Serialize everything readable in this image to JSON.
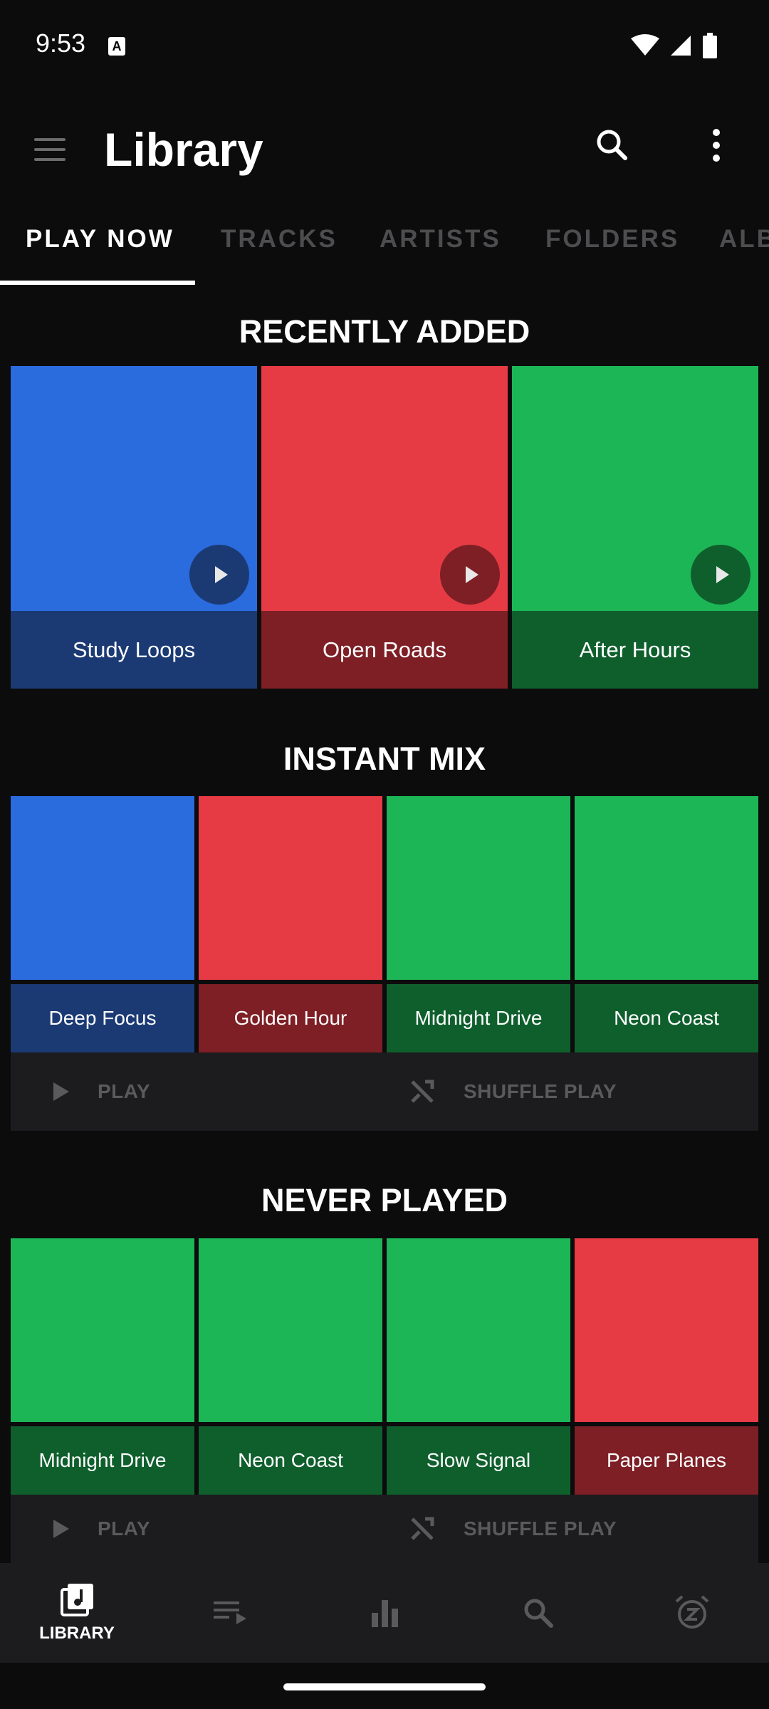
{
  "status_bar": {
    "time": "9:53",
    "badge": "A"
  },
  "app_bar": {
    "title": "Library"
  },
  "tabs": [
    {
      "label": "PLAY NOW",
      "active": true
    },
    {
      "label": "TRACKS",
      "active": false
    },
    {
      "label": "ARTISTS",
      "active": false
    },
    {
      "label": "FOLDERS",
      "active": false
    },
    {
      "label": "ALBUMS",
      "active": false
    }
  ],
  "recently_added": {
    "title": "RECENTLY ADDED",
    "items": [
      {
        "label": "Study Loops",
        "color": "blue"
      },
      {
        "label": "Open Roads",
        "color": "red"
      },
      {
        "label": "After Hours",
        "color": "green"
      }
    ]
  },
  "instant_mix": {
    "title": "INSTANT MIX",
    "items": [
      {
        "label": "Deep Focus",
        "color": "blue"
      },
      {
        "label": "Golden Hour",
        "color": "red"
      },
      {
        "label": "Midnight Drive",
        "color": "green"
      },
      {
        "label": "Neon Coast",
        "color": "green"
      }
    ],
    "play_label": "PLAY",
    "shuffle_label": "SHUFFLE PLAY"
  },
  "never_played": {
    "title": "NEVER PLAYED",
    "items": [
      {
        "label": "Midnight Drive",
        "color": "green"
      },
      {
        "label": "Neon Coast",
        "color": "green"
      },
      {
        "label": "Slow Signal",
        "color": "green"
      },
      {
        "label": "Paper Planes",
        "color": "red"
      }
    ],
    "play_label": "PLAY",
    "shuffle_label": "SHUFFLE PLAY"
  },
  "bottom_nav": [
    {
      "label": "LIBRARY",
      "icon": "library-icon",
      "active": true
    },
    {
      "label": "",
      "icon": "queue-icon",
      "active": false
    },
    {
      "label": "",
      "icon": "stats-icon",
      "active": false
    },
    {
      "label": "",
      "icon": "search-icon",
      "active": false
    },
    {
      "label": "",
      "icon": "sleep-timer-icon",
      "active": false
    }
  ],
  "colors": {
    "background": "#0c0c0d",
    "blue": "#2a6bde",
    "red": "#e63b45",
    "green": "#1db656"
  }
}
